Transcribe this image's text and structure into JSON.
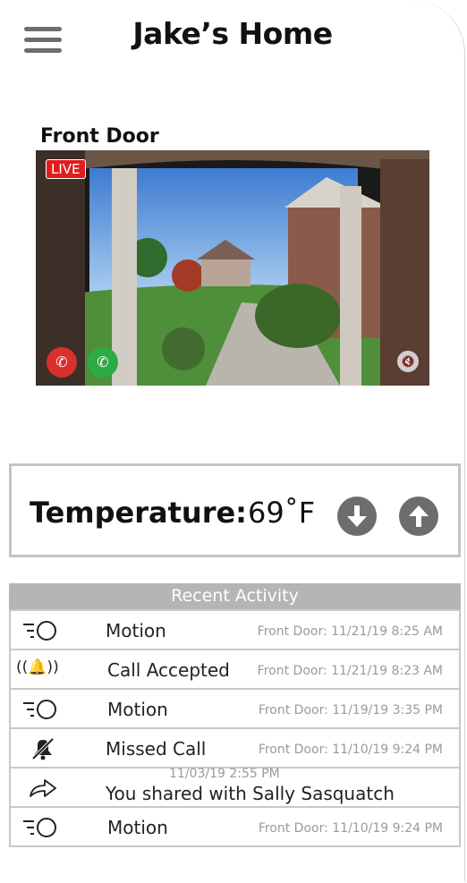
{
  "header": {
    "title": "Jake’s Home",
    "menu_icon": "hamburger-menu-icon"
  },
  "camera": {
    "label": "Front Door",
    "live_badge": "LIVE",
    "controls": {
      "decline_icon": "decline-call-icon",
      "accept_icon": "accept-call-icon",
      "mute_icon": "speaker-mute-icon"
    }
  },
  "thermostat": {
    "label": "Temperature:",
    "value": "69˚F",
    "decrease_icon": "arrow-down-circle-icon",
    "increase_icon": "arrow-up-circle-icon"
  },
  "activity": {
    "header": "Recent Activity",
    "items": [
      {
        "icon": "motion-icon",
        "label": "Motion",
        "meta": "Front Door: 11/21/19 8:25 AM"
      },
      {
        "icon": "ringing-bell-icon",
        "label": "Call Accepted",
        "meta": "Front Door: 11/21/19 8:23 AM"
      },
      {
        "icon": "motion-icon",
        "label": "Motion",
        "meta": "Front Door: 11/19/19 3:35 PM"
      },
      {
        "icon": "muted-bell-icon",
        "label": "Missed Call",
        "meta": "Front Door: 11/10/19 9:24 PM"
      },
      {
        "icon": "share-icon",
        "label": "You shared with Sally Sasquatch",
        "meta_top": "11/03/19 2:55 PM"
      },
      {
        "icon": "motion-icon",
        "label": "Motion",
        "meta": "Front Door: 11/10/19 9:24 PM"
      }
    ]
  },
  "colors": {
    "live": "#e01d1d",
    "accept": "#2eaa47",
    "decline": "#d8302c",
    "control_gray": "#6d6d6d",
    "border_gray": "#c4c4c4"
  }
}
